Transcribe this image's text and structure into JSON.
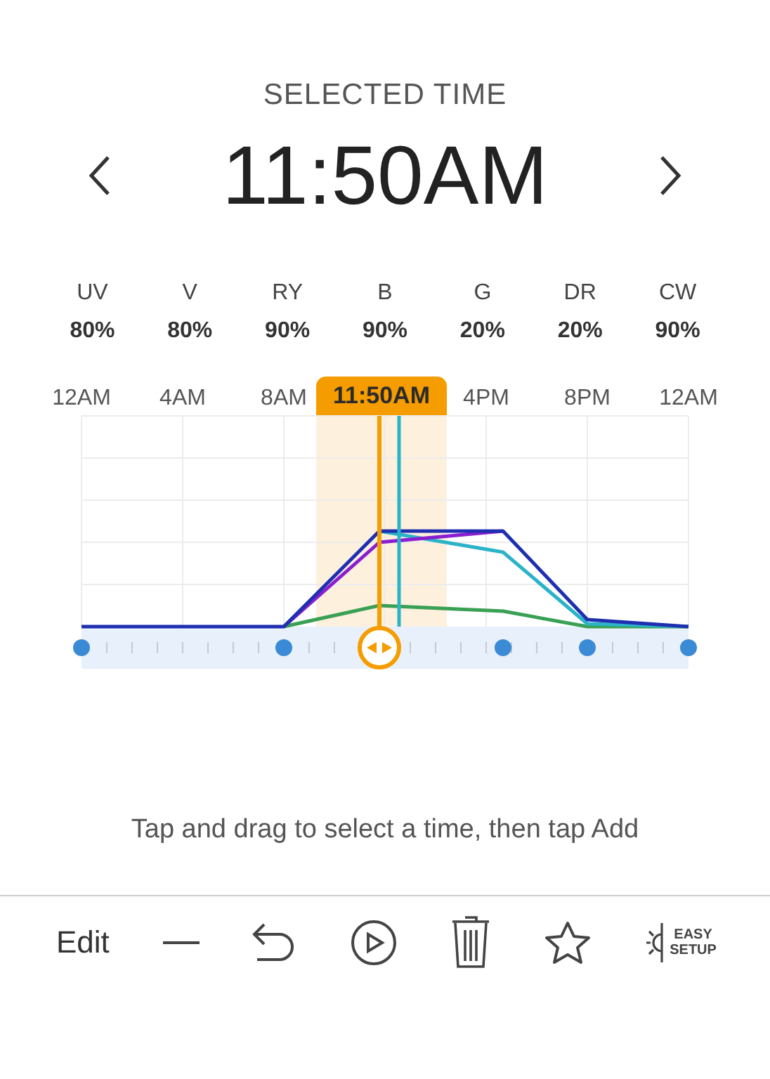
{
  "header": {
    "title": "SELECTED TIME",
    "time": "11:50AM"
  },
  "channels": [
    {
      "name": "UV",
      "value": "80%"
    },
    {
      "name": "V",
      "value": "80%"
    },
    {
      "name": "RY",
      "value": "90%"
    },
    {
      "name": "B",
      "value": "90%"
    },
    {
      "name": "G",
      "value": "20%"
    },
    {
      "name": "DR",
      "value": "20%"
    },
    {
      "name": "CW",
      "value": "90%"
    }
  ],
  "timeline": {
    "labels": [
      "12AM",
      "4AM",
      "8AM",
      "4PM",
      "8PM",
      "12AM"
    ],
    "selected_label": "11:50AM"
  },
  "hint": "Tap and drag to select a time, then tap Add",
  "toolbar": {
    "edit": "Edit",
    "easy_setup": [
      "EASY",
      "SETUP"
    ]
  }
}
